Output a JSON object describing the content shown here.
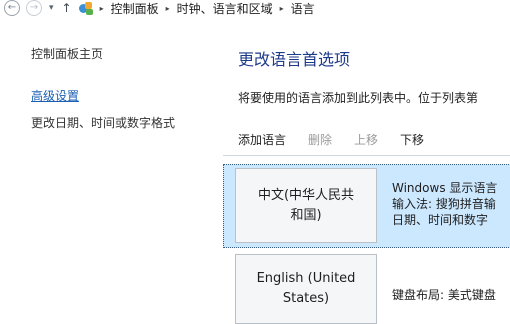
{
  "nav": {
    "back": "←",
    "forward": "→",
    "dropdown": "▾",
    "up": "↑",
    "breadcrumbs": [
      "控制面板",
      "时钟、语言和区域",
      "语言"
    ],
    "separator": "▸"
  },
  "sidebar": {
    "items": [
      {
        "label": "控制面板主页"
      },
      {
        "label": "高级设置"
      },
      {
        "label": "更改日期、时间或数字格式"
      }
    ]
  },
  "main": {
    "title": "更改语言首选项",
    "description": "将要使用的语言添加到此列表中。位于列表第",
    "toolbar": {
      "add": "添加语言",
      "remove": "删除",
      "move_up": "上移",
      "move_down": "下移"
    },
    "languages": [
      {
        "name": "中文(中华人民共和国)",
        "name_lines": [
          "中文(中华人民共",
          "和国)"
        ],
        "info": [
          "Windows 显示语言",
          "输入法: 搜狗拼音输",
          "日期、时间和数字"
        ]
      },
      {
        "name": "English (United States)",
        "name_lines": [
          "English (United",
          "States)"
        ],
        "info": [
          "键盘布局: 美式键盘"
        ]
      }
    ]
  },
  "colors": {
    "accent_link": "#1a5fb4",
    "title": "#1e3a8a",
    "selected_row": "#cce8ff",
    "disabled_text": "#9a9a9a"
  }
}
